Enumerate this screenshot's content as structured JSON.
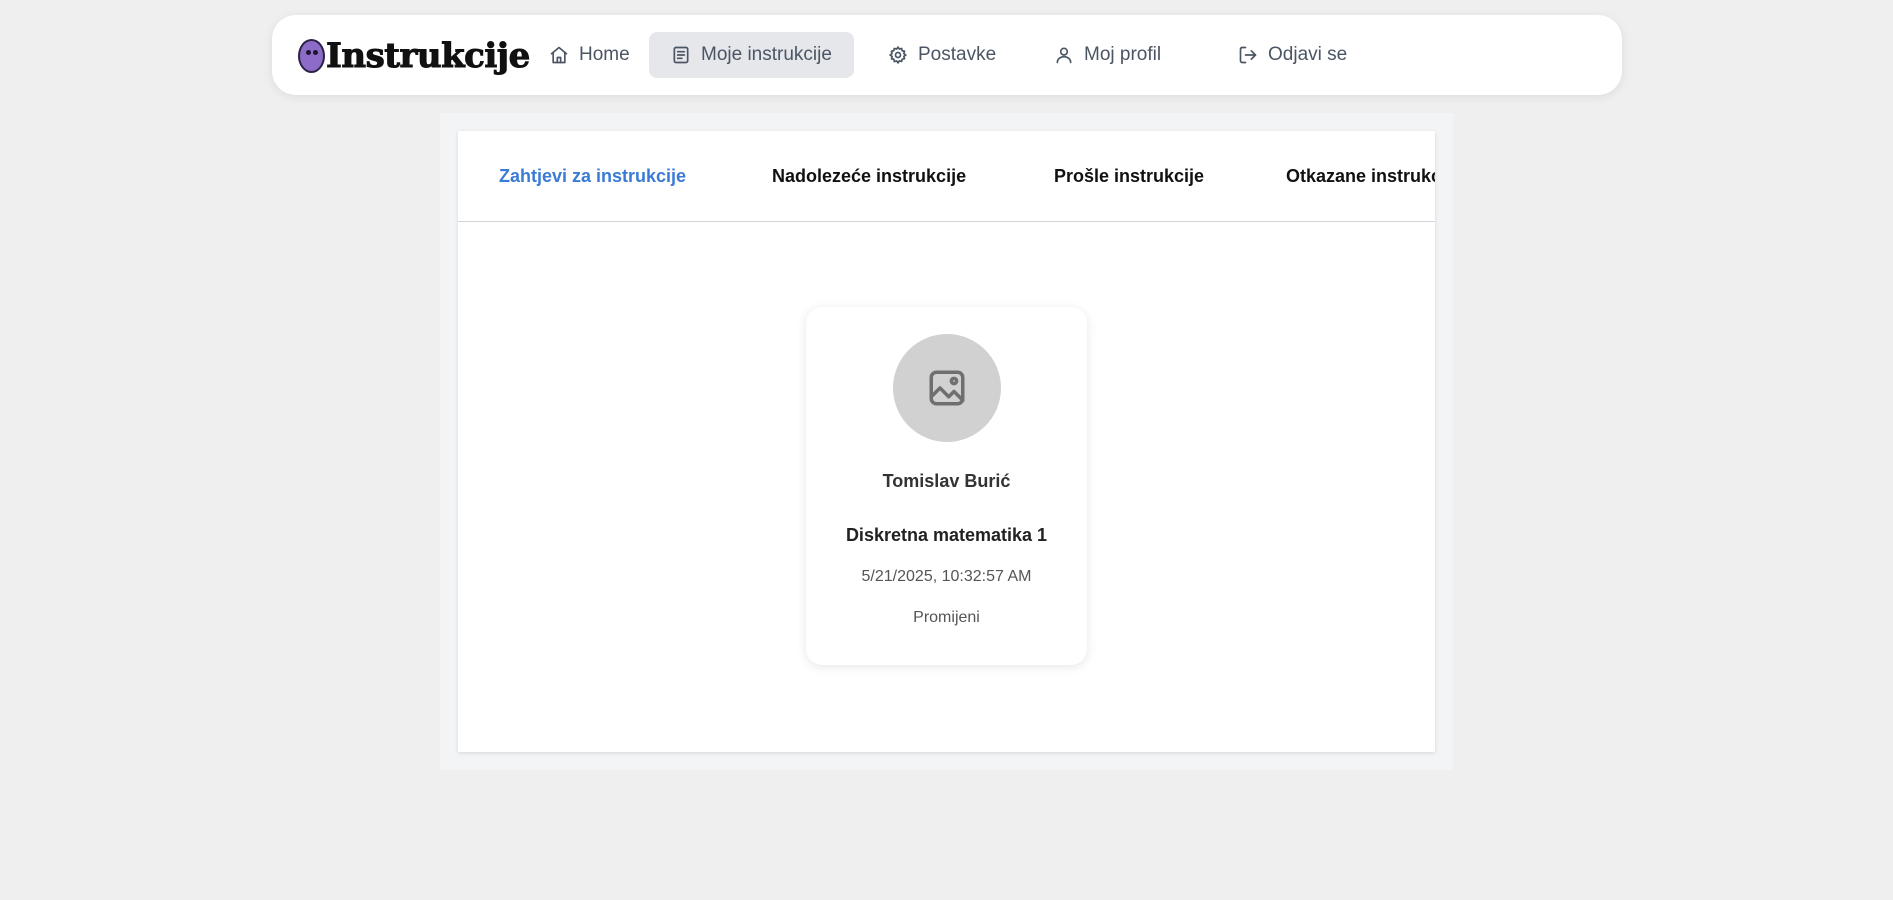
{
  "brand": {
    "name": "Instrukcije"
  },
  "nav": {
    "items": [
      {
        "label": "Home",
        "icon": "home-icon"
      },
      {
        "label": "Moje instrukcije",
        "icon": "document-icon",
        "active": true
      },
      {
        "label": "Postavke",
        "icon": "gear-icon"
      },
      {
        "label": "Moj profil",
        "icon": "user-icon"
      },
      {
        "label": "Odjavi se",
        "icon": "logout-icon"
      }
    ]
  },
  "tabs": [
    {
      "label": "Zahtjevi za instrukcije",
      "active": true
    },
    {
      "label": "Nadolezeće instrukcije"
    },
    {
      "label": "Prošle instrukcije"
    },
    {
      "label": "Otkazane instrukcije"
    }
  ],
  "card": {
    "avatar_icon": "image-placeholder-icon",
    "name": "Tomislav Burić",
    "subject": "Diskretna matematika 1",
    "datetime": "5/21/2025, 10:32:57 AM",
    "action_label": "Promijeni"
  },
  "colors": {
    "accent": "#3a7bd5",
    "active_nav_bg": "#e5e7eb",
    "page_bg": "#efefef",
    "logo_purple": "#8d6cc8"
  }
}
